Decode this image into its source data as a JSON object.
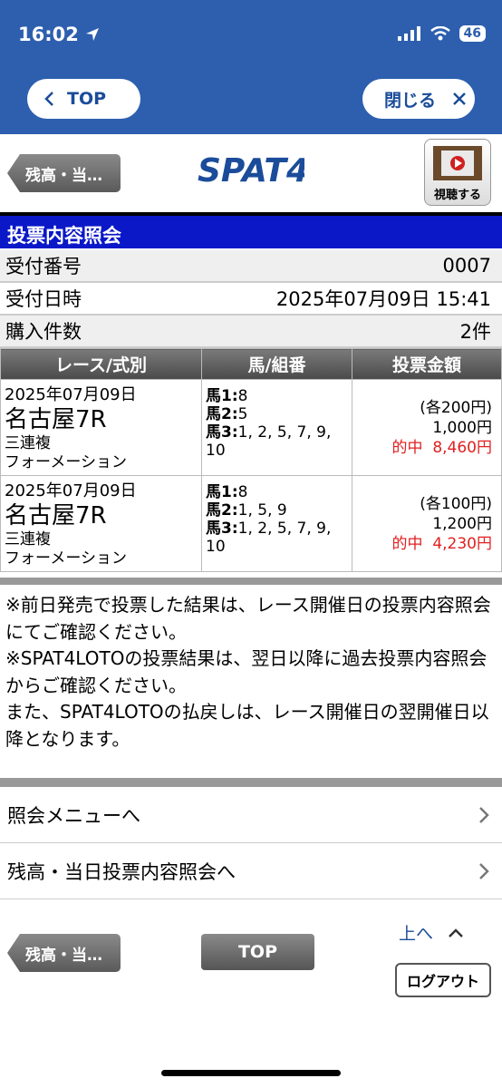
{
  "status": {
    "time": "16:02",
    "battery": "46"
  },
  "nav": {
    "top_label": "TOP",
    "close_label": "閉じる"
  },
  "header": {
    "back_label": "残高・当…",
    "logo_text": "SPAT4",
    "watch_label": "視聴する"
  },
  "section_title": "投票内容照会",
  "info": [
    {
      "label": "受付番号",
      "value": "0007"
    },
    {
      "label": "受付日時",
      "value": "2025年07月09日 15:41"
    },
    {
      "label": "購入件数",
      "value": "2件"
    }
  ],
  "table": {
    "headers": [
      "レース/式別",
      "馬/組番",
      "投票金額"
    ],
    "rows": [
      {
        "date": "2025年07月09日",
        "venue": "名古屋7R",
        "type": "三連複",
        "method": "フォーメーション",
        "h1_label": "馬1:",
        "h1": "8",
        "h2_label": "馬2:",
        "h2": "5",
        "h3_label": "馬3:",
        "h3": "1, 2, 5, 7, 9, 10",
        "unit": "(各200円)",
        "total": "1,000円",
        "hit_label": "的中",
        "payout": "8,460円"
      },
      {
        "date": "2025年07月09日",
        "venue": "名古屋7R",
        "type": "三連複",
        "method": "フォーメーション",
        "h1_label": "馬1:",
        "h1": "8",
        "h2_label": "馬2:",
        "h2": "1, 5, 9",
        "h3_label": "馬3:",
        "h3": "1, 2, 5, 7, 9, 10",
        "unit": "(各100円)",
        "total": "1,200円",
        "hit_label": "的中",
        "payout": "4,230円"
      }
    ]
  },
  "notes": [
    "※前日発売で投票した結果は、レース開催日の投票内容照会にてご確認ください。",
    "※SPAT4LOTOの投票結果は、翌日以降に過去投票内容照会からご確認ください。",
    "また、SPAT4LOTOの払戻しは、レース開催日の翌開催日以降となります。"
  ],
  "menu": [
    {
      "label": "照会メニューへ"
    },
    {
      "label": "残高・当日投票内容照会へ"
    }
  ],
  "footer": {
    "back_label": "残高・当…",
    "top_label": "TOP",
    "up_label": "上へ",
    "logout_label": "ログアウト"
  },
  "colors": {
    "nav_blue": "#2d5fae",
    "title_blue": "#0a18c8",
    "hit_red": "#e02020"
  }
}
